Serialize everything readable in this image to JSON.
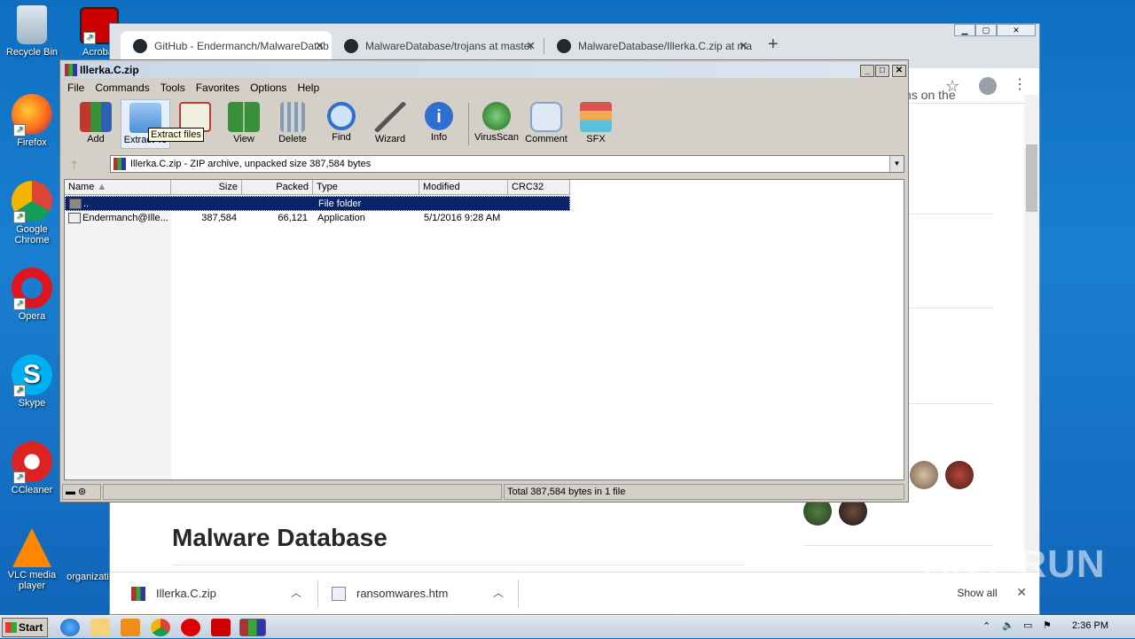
{
  "desktop": {
    "icons": [
      {
        "label": "Recycle Bin"
      },
      {
        "label": "Acrobat"
      },
      {
        "label": "Firefox"
      },
      {
        "label": "Google Chrome"
      },
      {
        "label": "Opera"
      },
      {
        "label": "Skype"
      },
      {
        "label": "CCleaner"
      },
      {
        "label": "VLC media player"
      },
      {
        "label": "organizati"
      }
    ]
  },
  "chrome": {
    "tabs": [
      {
        "title": "GitHub - Endermanch/MalwareDatab",
        "close": "✕"
      },
      {
        "title": "MalwareDatabase/trojans at master",
        "close": "✕"
      },
      {
        "title": "MalwareDatabase/Illerka.C.zip at ma",
        "close": "✕"
      }
    ],
    "new_tab": "+",
    "page_snippet": "ns on the",
    "heading": "Malware Database",
    "downloads": [
      {
        "name": "Illerka.C.zip"
      },
      {
        "name": "ransomwares.htm"
      }
    ],
    "show_all": "Show all",
    "close_bar": "✕"
  },
  "winrar": {
    "title": "Illerka.C.zip",
    "menu": [
      "File",
      "Commands",
      "Tools",
      "Favorites",
      "Options",
      "Help"
    ],
    "tools": [
      {
        "label": "Add",
        "color": "#c0392b"
      },
      {
        "label": "Extract To",
        "color": "#4a90d9"
      },
      {
        "label": "Test",
        "color": "#c0392b"
      },
      {
        "label": "View",
        "color": "#3a8f3a"
      },
      {
        "label": "Delete",
        "color": "#7a8a9a"
      },
      {
        "label": "Find",
        "color": "#2f6fcf"
      },
      {
        "label": "Wizard",
        "color": "#b0b0b0"
      },
      {
        "label": "Info",
        "color": "#2f6fcf"
      },
      {
        "label": "VirusScan",
        "color": "#2e8b2e"
      },
      {
        "label": "Comment",
        "color": "#8aa4c8"
      },
      {
        "label": "SFX",
        "color": "#d9534f"
      }
    ],
    "tooltip": "Extract files",
    "address": "Illerka.C.zip - ZIP archive, unpacked size 387,584 bytes",
    "columns": [
      "Name",
      "Size",
      "Packed",
      "Type",
      "Modified",
      "CRC32"
    ],
    "rows": [
      {
        "name": "..",
        "size": "",
        "packed": "",
        "type": "File folder",
        "modified": "",
        "crc": ""
      },
      {
        "name": "Endermanch@Ille...",
        "size": "387,584",
        "packed": "66,121",
        "type": "Application",
        "modified": "5/1/2016 9:28 AM",
        "crc": ""
      }
    ],
    "status": "Total 387,584 bytes in 1 file"
  },
  "taskbar": {
    "start": "Start",
    "clock": "2:36 PM"
  },
  "watermark": "ANY RUN"
}
